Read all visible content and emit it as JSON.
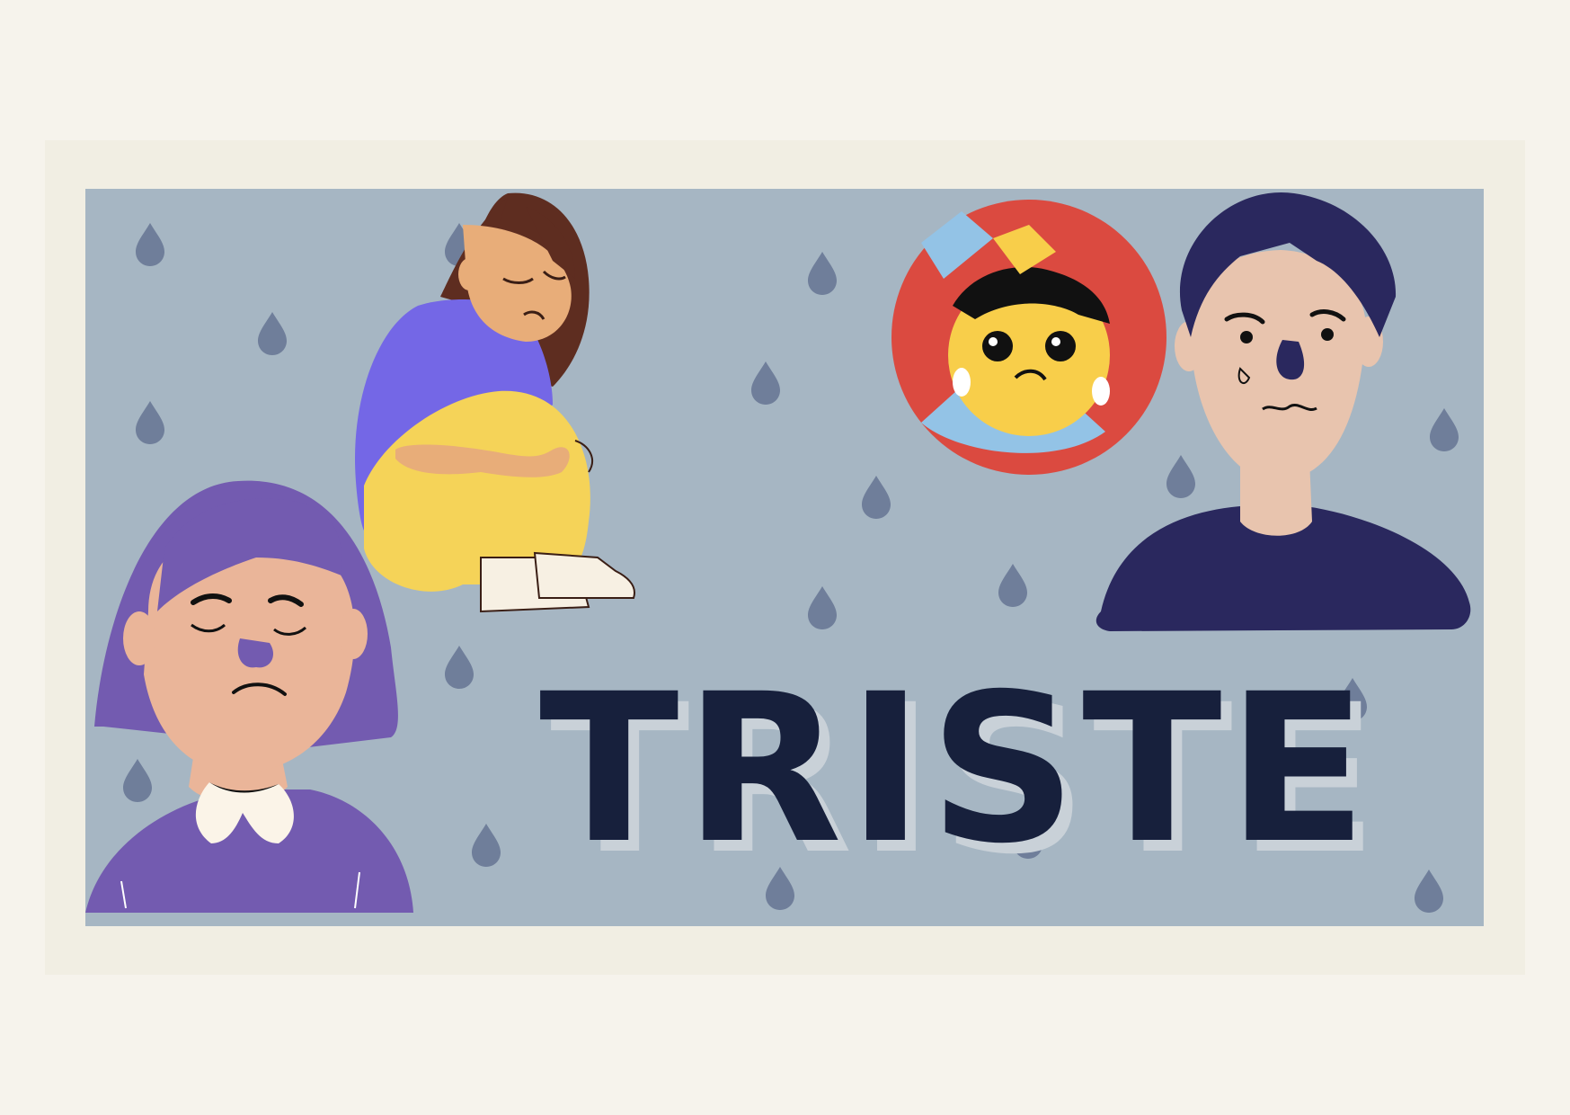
{
  "title": "TRISTE",
  "colors": {
    "page_background": "#f6f3ec",
    "frame": "#f1eee3",
    "panel": "#a6b6c3",
    "raindrop": "#6f7e9a",
    "title_text": "#17203c",
    "title_shadow": "#c9d1d8"
  },
  "illustrations": [
    {
      "name": "purple-haired-woman",
      "hair": "#735bb0",
      "shirt": "#735bb0",
      "skin": "#eab599"
    },
    {
      "name": "girl-hugging-knees",
      "hair": "#5e2d20",
      "shirt": "#7467e6",
      "pants": "#f5d358",
      "skin": "#e8ad79"
    },
    {
      "name": "crying-child-badge",
      "badge": "#db4a40",
      "face": "#f8ce4a",
      "sleeve": "#93c3e6"
    },
    {
      "name": "man-with-tear",
      "hair": "#2a285e",
      "shirt": "#2a285e",
      "skin": "#e8c4ae"
    }
  ]
}
